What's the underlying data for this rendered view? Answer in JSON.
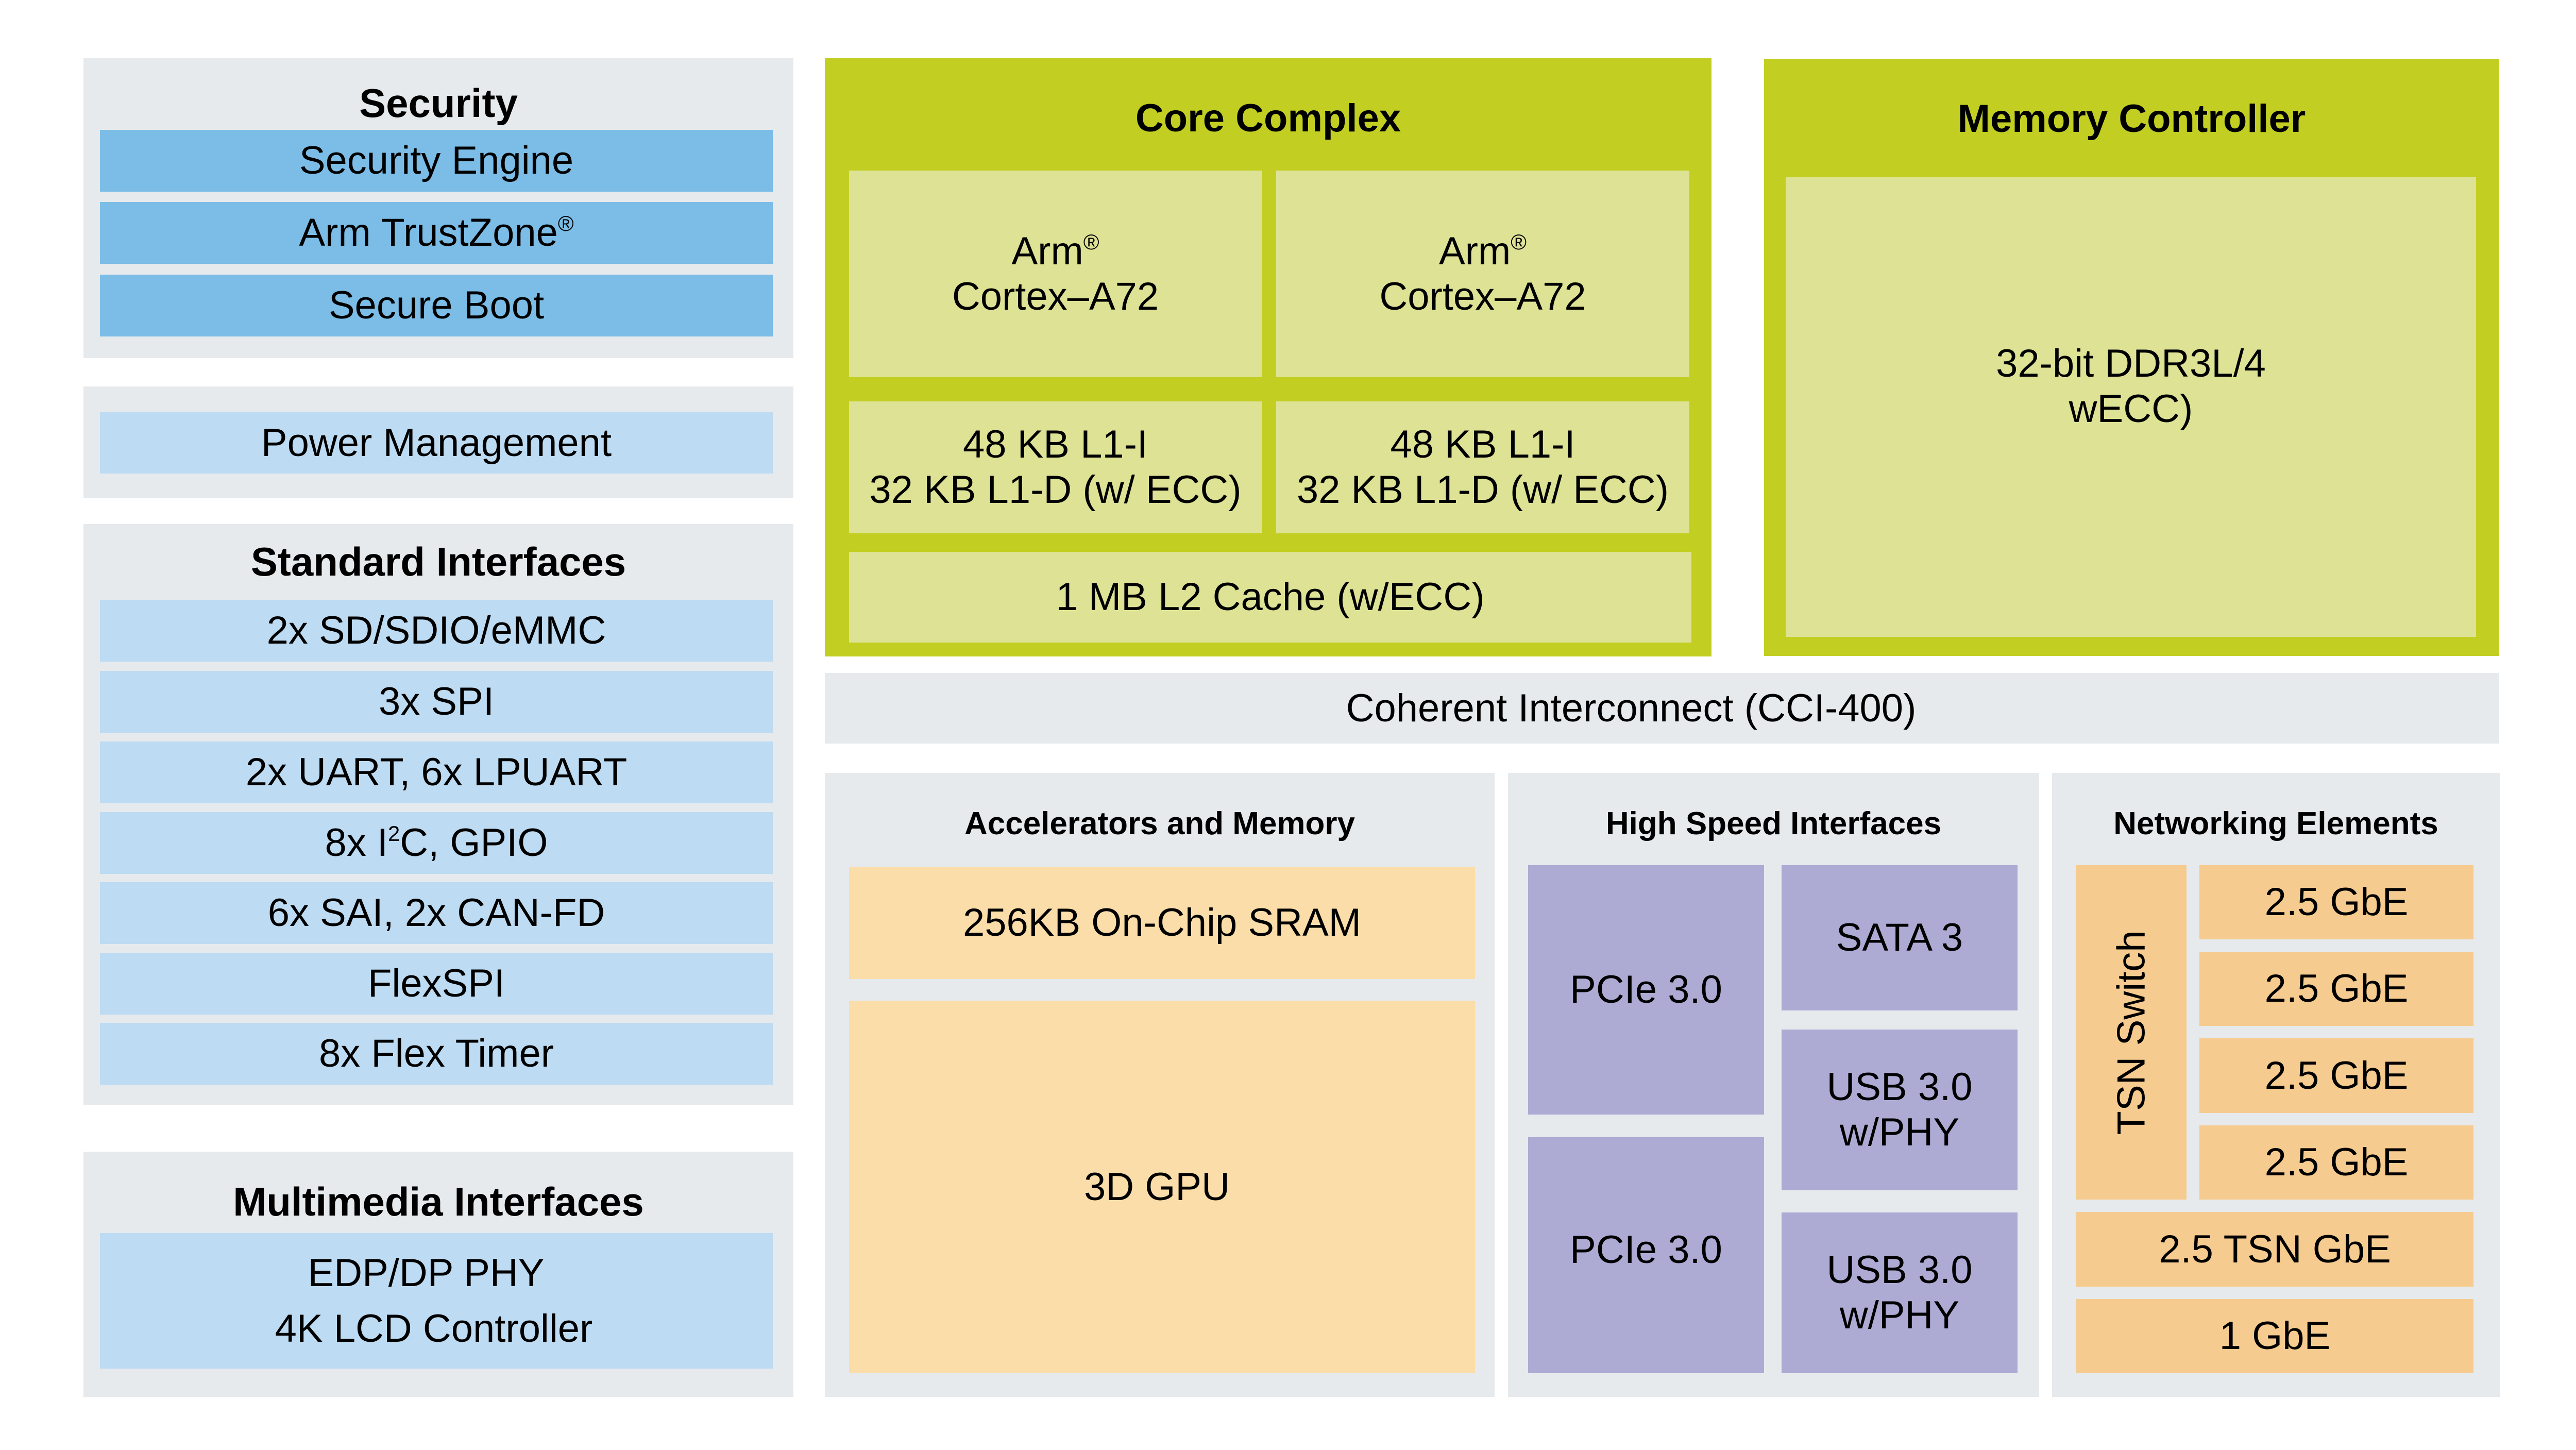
{
  "colors": {
    "panel_gray": "#E6EAED",
    "core_green": "#C2CF22",
    "core_light_green": "#DEE295",
    "security_blue": "#7BBDE6",
    "interface_light_blue": "#BDDBF2",
    "accelerator_peach": "#FADDA9",
    "networking_orange": "#F6CB8F",
    "high_speed_purple": "#ADABD4"
  },
  "security": {
    "title": "Security",
    "items": [
      {
        "label": "Security Engine",
        "sup": ""
      },
      {
        "label": "Arm TrustZone",
        "sup": "®"
      },
      {
        "label": "Secure Boot",
        "sup": ""
      }
    ]
  },
  "power": {
    "items": [
      {
        "label": "Power Management"
      }
    ]
  },
  "standard_interfaces": {
    "title": "Standard Interfaces",
    "items": [
      {
        "label": "2x SD/SDIO/eMMC"
      },
      {
        "label": "3x SPI"
      },
      {
        "label": "2x UART, 6x LPUART"
      },
      {
        "pre": "8x I",
        "sup": "2",
        "post": "C, GPIO"
      },
      {
        "label": "6x SAI, 2x CAN-FD"
      },
      {
        "label": "FlexSPI"
      },
      {
        "label": "8x Flex Timer"
      }
    ]
  },
  "multimedia": {
    "title": "Multimedia Interfaces",
    "lines": [
      "EDP/DP PHY",
      "4K LCD Controller"
    ]
  },
  "core_complex": {
    "title": "Core Complex",
    "cores": [
      {
        "brand": "Arm",
        "sup": "®",
        "name": "Cortex–A72",
        "l1_i": "48 KB L1-I",
        "l1_d": "32 KB L1-D (w/ ECC)"
      },
      {
        "brand": "Arm",
        "sup": "®",
        "name": "Cortex–A72",
        "l1_i": "48 KB L1-I",
        "l1_d": "32 KB L1-D (w/ ECC)"
      }
    ],
    "l2": "1 MB L2 Cache (w/ECC)"
  },
  "memory_controller": {
    "title": "Memory Controller",
    "lines": [
      "32-bit DDR3L/4",
      "wECC)"
    ]
  },
  "interconnect": {
    "label": "Coherent Interconnect (CCI-400)"
  },
  "accelerators": {
    "title": "Accelerators and Memory",
    "items": [
      {
        "label": "256KB On-Chip SRAM"
      },
      {
        "label": "3D GPU"
      }
    ]
  },
  "high_speed": {
    "title": "High Speed Interfaces",
    "pcie": [
      {
        "label": "PCIe 3.0"
      },
      {
        "label": "PCIe 3.0"
      }
    ],
    "sata": {
      "label": "SATA 3"
    },
    "usb": [
      {
        "line1": "USB 3.0",
        "line2": "w/PHY"
      },
      {
        "line1": "USB 3.0",
        "line2": "w/PHY"
      }
    ]
  },
  "networking": {
    "title": "Networking Elements",
    "switch": "TSN Switch",
    "ports": [
      {
        "label": "2.5 GbE"
      },
      {
        "label": "2.5 GbE"
      },
      {
        "label": "2.5 GbE"
      },
      {
        "label": "2.5 GbE"
      }
    ],
    "tsn_gbe": "2.5 TSN GbE",
    "gbe": "1 GbE"
  }
}
